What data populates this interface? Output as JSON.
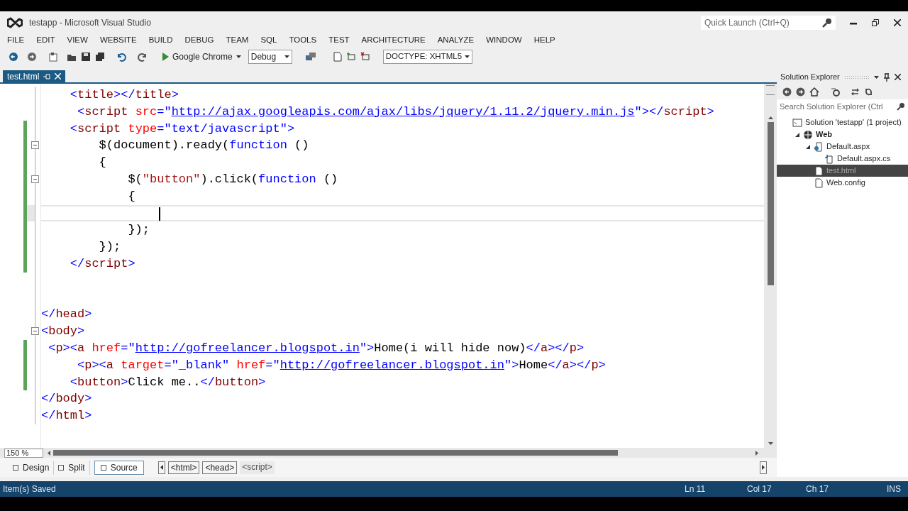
{
  "window": {
    "title": "testapp - Microsoft Visual Studio"
  },
  "quick_launch": {
    "placeholder": "Quick Launch (Ctrl+Q)"
  },
  "menu": [
    "FILE",
    "EDIT",
    "VIEW",
    "WEBSITE",
    "BUILD",
    "DEBUG",
    "TEAM",
    "SQL",
    "TOOLS",
    "TEST",
    "ARCHITECTURE",
    "ANALYZE",
    "WINDOW",
    "HELP"
  ],
  "toolbar": {
    "run_target": "Google Chrome",
    "configuration": "Debug",
    "doctype": "DOCTYPE: XHTML5"
  },
  "tabs": [
    {
      "label": "test.html",
      "selected": true
    }
  ],
  "editor": {
    "lines": [
      {
        "current": false,
        "changed": false,
        "fold": false,
        "segments": [
          {
            "text": "    <",
            "kind": "delim"
          },
          {
            "text": "title",
            "kind": "tag"
          },
          {
            "text": "></",
            "kind": "delim"
          },
          {
            "text": "title",
            "kind": "tag"
          },
          {
            "text": ">",
            "kind": "delim"
          }
        ]
      },
      {
        "current": false,
        "changed": false,
        "fold": false,
        "segments": [
          {
            "text": "     <",
            "kind": "delim"
          },
          {
            "text": "script",
            "kind": "tag"
          },
          {
            "text": " src",
            "kind": "attr"
          },
          {
            "text": "=\"",
            "kind": "delim"
          },
          {
            "text": "http://ajax.googleapis.com/ajax/libs/jquery/1.11.2/jquery.min.js",
            "kind": "link"
          },
          {
            "text": "\"></",
            "kind": "delim"
          },
          {
            "text": "script",
            "kind": "tag"
          },
          {
            "text": ">",
            "kind": "delim"
          }
        ]
      },
      {
        "current": false,
        "changed": true,
        "fold": false,
        "segments": [
          {
            "text": "    <",
            "kind": "delim"
          },
          {
            "text": "script",
            "kind": "tag"
          },
          {
            "text": " type",
            "kind": "attr"
          },
          {
            "text": "=\"text/javascript\">",
            "kind": "delim"
          }
        ]
      },
      {
        "current": false,
        "changed": true,
        "fold": true,
        "segments": [
          {
            "text": "        $(document).ready(",
            "kind": "plain"
          },
          {
            "text": "function",
            "kind": "keyword"
          },
          {
            "text": " ()",
            "kind": "plain"
          }
        ]
      },
      {
        "current": false,
        "changed": true,
        "fold": false,
        "segments": [
          {
            "text": "        {",
            "kind": "plain"
          }
        ]
      },
      {
        "current": false,
        "changed": true,
        "fold": true,
        "segments": [
          {
            "text": "            $(",
            "kind": "plain"
          },
          {
            "text": "\"button\"",
            "kind": "string"
          },
          {
            "text": ").click(",
            "kind": "plain"
          },
          {
            "text": "function",
            "kind": "keyword"
          },
          {
            "text": " ()",
            "kind": "plain"
          }
        ]
      },
      {
        "current": false,
        "changed": true,
        "fold": false,
        "segments": [
          {
            "text": "            {",
            "kind": "plain"
          }
        ]
      },
      {
        "current": true,
        "changed": true,
        "fold": false,
        "kind": "blank"
      },
      {
        "current": false,
        "changed": true,
        "fold": false,
        "segments": [
          {
            "text": "            });",
            "kind": "plain"
          }
        ]
      },
      {
        "current": false,
        "changed": true,
        "fold": false,
        "segments": [
          {
            "text": "        });",
            "kind": "plain"
          }
        ]
      },
      {
        "current": false,
        "changed": true,
        "fold": false,
        "segments": [
          {
            "text": "    </",
            "kind": "delim"
          },
          {
            "text": "script",
            "kind": "tag"
          },
          {
            "text": ">",
            "kind": "delim"
          }
        ]
      },
      {
        "current": false,
        "changed": false,
        "fold": false,
        "kind": "blank"
      },
      {
        "current": false,
        "changed": false,
        "fold": false,
        "kind": "blank"
      },
      {
        "current": false,
        "changed": false,
        "fold": false,
        "segments": [
          {
            "text": "</",
            "kind": "delim"
          },
          {
            "text": "head",
            "kind": "tag"
          },
          {
            "text": ">",
            "kind": "delim"
          }
        ]
      },
      {
        "current": false,
        "changed": false,
        "fold": true,
        "segments": [
          {
            "text": "<",
            "kind": "delim"
          },
          {
            "text": "body",
            "kind": "tag"
          },
          {
            "text": ">",
            "kind": "delim"
          }
        ]
      },
      {
        "current": false,
        "changed": true,
        "fold": false,
        "segments": [
          {
            "text": " <",
            "kind": "delim"
          },
          {
            "text": "p",
            "kind": "tag"
          },
          {
            "text": "><",
            "kind": "delim"
          },
          {
            "text": "a",
            "kind": "tag"
          },
          {
            "text": " href",
            "kind": "attr"
          },
          {
            "text": "=\"",
            "kind": "delim"
          },
          {
            "text": "http://gofreelancer.blogspot.in",
            "kind": "link"
          },
          {
            "text": "\">",
            "kind": "delim"
          },
          {
            "text": "Home(i will hide now)",
            "kind": "plain"
          },
          {
            "text": "</",
            "kind": "delim"
          },
          {
            "text": "a",
            "kind": "tag"
          },
          {
            "text": "></",
            "kind": "delim"
          },
          {
            "text": "p",
            "kind": "tag"
          },
          {
            "text": ">",
            "kind": "delim"
          }
        ]
      },
      {
        "current": false,
        "changed": true,
        "fold": false,
        "segments": [
          {
            "text": "     <",
            "kind": "delim"
          },
          {
            "text": "p",
            "kind": "tag"
          },
          {
            "text": "><",
            "kind": "delim"
          },
          {
            "text": "a",
            "kind": "tag"
          },
          {
            "text": " target",
            "kind": "attr"
          },
          {
            "text": "=\"_blank\"",
            "kind": "delim"
          },
          {
            "text": " href",
            "kind": "attr"
          },
          {
            "text": "=\"",
            "kind": "delim"
          },
          {
            "text": "http://gofreelancer.blogspot.in",
            "kind": "link"
          },
          {
            "text": "\">",
            "kind": "delim"
          },
          {
            "text": "Home",
            "kind": "plain"
          },
          {
            "text": "</",
            "kind": "delim"
          },
          {
            "text": "a",
            "kind": "tag"
          },
          {
            "text": "></",
            "kind": "delim"
          },
          {
            "text": "p",
            "kind": "tag"
          },
          {
            "text": ">",
            "kind": "delim"
          }
        ]
      },
      {
        "current": false,
        "changed": true,
        "fold": false,
        "segments": [
          {
            "text": "    <",
            "kind": "delim"
          },
          {
            "text": "button",
            "kind": "tag"
          },
          {
            "text": ">",
            "kind": "delim"
          },
          {
            "text": "Click me..",
            "kind": "plain"
          },
          {
            "text": "</",
            "kind": "delim"
          },
          {
            "text": "button",
            "kind": "tag"
          },
          {
            "text": ">",
            "kind": "delim"
          }
        ]
      },
      {
        "current": false,
        "changed": false,
        "fold": false,
        "segments": [
          {
            "text": "</",
            "kind": "delim"
          },
          {
            "text": "body",
            "kind": "tag"
          },
          {
            "text": ">",
            "kind": "delim"
          }
        ]
      },
      {
        "current": false,
        "changed": false,
        "fold": false,
        "segments": [
          {
            "text": "</",
            "kind": "delim"
          },
          {
            "text": "html",
            "kind": "tag"
          },
          {
            "text": ">",
            "kind": "delim"
          }
        ]
      }
    ],
    "zoom": "150 %"
  },
  "view_tabs": [
    {
      "label": "Design",
      "selected": false
    },
    {
      "label": "Split",
      "selected": false
    },
    {
      "label": "Source",
      "selected": true
    }
  ],
  "breadcrumbs": [
    {
      "label": "<html>",
      "selected": false
    },
    {
      "label": "<head>",
      "selected": false
    },
    {
      "label": "<script>",
      "selected": true
    }
  ],
  "solution_explorer": {
    "title": "Solution Explorer",
    "search": {
      "placeholder": "Search Solution Explorer (Ctrl"
    },
    "items": [
      {
        "label": "Solution 'testapp' (1 project)",
        "kind": "solution",
        "selected": false,
        "children": [
          {
            "label": "Web",
            "kind": "project",
            "expanded": true,
            "selected": false,
            "children": [
              {
                "label": "Default.aspx",
                "kind": "page",
                "expanded": true,
                "selected": false,
                "children": [
                  {
                    "label": "Default.aspx.cs",
                    "kind": "code",
                    "selected": false
                  }
                ]
              },
              {
                "label": "test.html",
                "kind": "file",
                "selected": true
              },
              {
                "label": "Web.config",
                "kind": "file",
                "selected": false
              }
            ]
          }
        ]
      }
    ]
  },
  "status_bar": {
    "message": "Item(s) Saved",
    "line": "Ln 11",
    "col": "Col 17",
    "ch": "Ch 17",
    "mode": "INS"
  }
}
